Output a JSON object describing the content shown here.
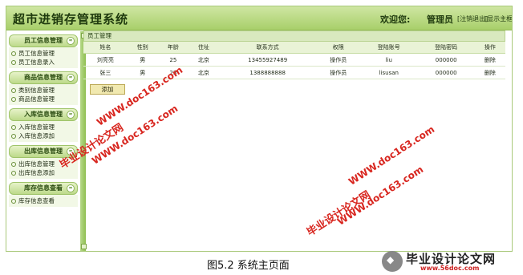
{
  "header": {
    "title": "超市进销存管理系统",
    "welcome": "欢迎您:",
    "user": "管理员",
    "logout": "[注销退出]",
    "home": "[显示主框架]"
  },
  "sidebar": {
    "sections": [
      {
        "title": "员工信息管理",
        "items": [
          "员工信息管理",
          "员工信息录入"
        ]
      },
      {
        "title": "商品信息管理",
        "items": [
          "类别信息管理",
          "商品信息管理"
        ]
      },
      {
        "title": "入库信息管理",
        "items": [
          "入库信息管理",
          "入库信息添加"
        ]
      },
      {
        "title": "出库信息管理",
        "items": [
          "出库信息管理",
          "出库信息添加"
        ]
      },
      {
        "title": "库存信息查看",
        "items": [
          "库存信息查看"
        ]
      }
    ]
  },
  "main": {
    "panel_title": "员工管理",
    "columns": [
      "姓名",
      "性别",
      "年龄",
      "住址",
      "联系方式",
      "权限",
      "登陆账号",
      "登陆密码",
      "操作"
    ],
    "rows": [
      [
        "刘亮亮",
        "男",
        "25",
        "北京",
        "13455927489",
        "操作员",
        "liu",
        "000000",
        "删除"
      ],
      [
        "张三",
        "男",
        "23",
        "北京",
        "1388888888",
        "操作员",
        "lisusan",
        "000000",
        "删除"
      ]
    ],
    "add_label": "添加"
  },
  "caption": "图5.2 系统主页面",
  "watermarks": {
    "cn": "毕业设计论文网",
    "url": "WWW.doc163.com",
    "footer_brand": "毕业设计论文网",
    "footer_url": "www.56doc.com"
  },
  "colors": {
    "accent": "#a8cf6a",
    "watermark": "#d8261f"
  }
}
